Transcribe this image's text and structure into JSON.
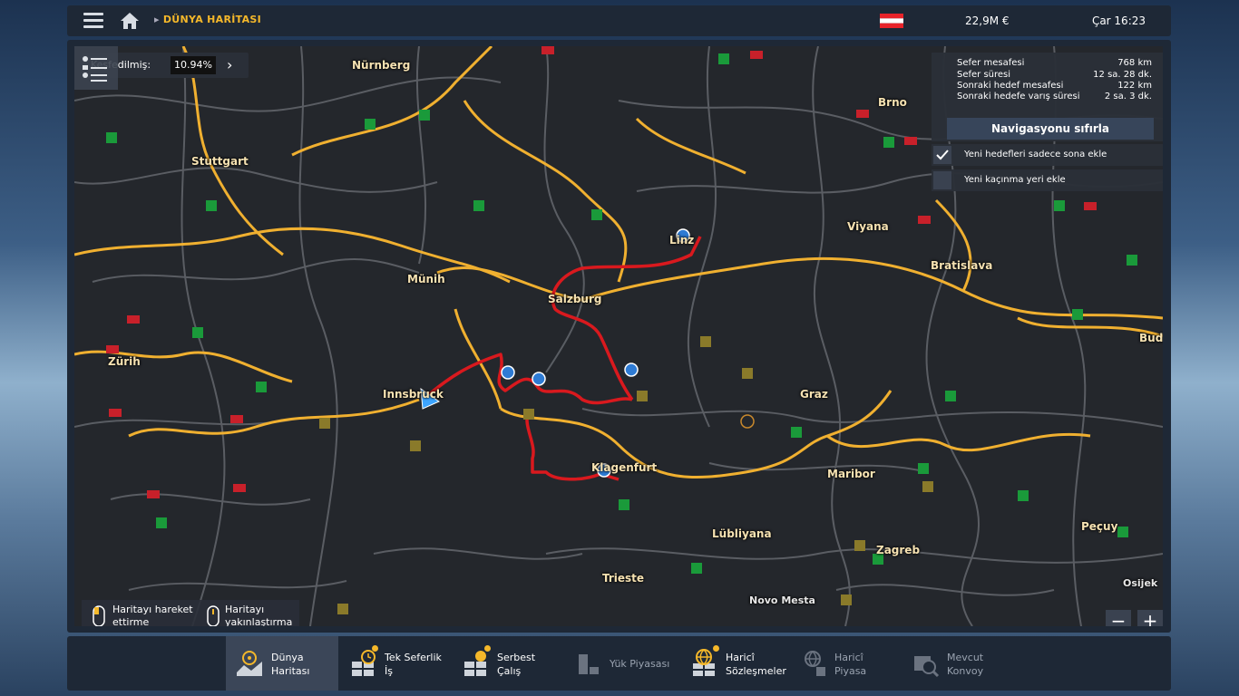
{
  "topbar": {
    "breadcrumb": "DÜNYA HARİTASI",
    "money": "22,9M  €",
    "clock": "Çar 16:23",
    "flag_colors": [
      "#e8232a",
      "#ffffff",
      "#e8232a"
    ]
  },
  "explored": {
    "label": "Keşfedilmiş:",
    "value": "10.94%"
  },
  "route_info": {
    "rows": [
      {
        "key": "Sefer mesafesi",
        "value": "768 km"
      },
      {
        "key": "Sefer süresi",
        "value": "12 sa. 28 dk."
      },
      {
        "key": "Sonraki hedef mesafesi",
        "value": "122 km"
      },
      {
        "key": "Sonraki hedefe varış süresi",
        "value": "2 sa. 3 dk."
      }
    ],
    "reset_button": "Navigasyonu sıfırla"
  },
  "options": [
    {
      "label": "Yeni hedefleri sadece sona ekle",
      "checked": true
    },
    {
      "label": "Yeni kaçınma yeri ekle",
      "checked": false
    }
  ],
  "cities": [
    "Nürnberg",
    "Stuttgart",
    "Brno",
    "Viyana",
    "Bratislava",
    "Münih",
    "Salzburg",
    "Linz",
    "Zürih",
    "Innsbruck",
    "Graz",
    "Budap",
    "Maribor",
    "Klagenfurt",
    "Lübliyana",
    "Zagreb",
    "Peçuy",
    "Trieste",
    "Novo Mesta",
    "Osijek"
  ],
  "hints": {
    "move": "Haritayı hareket\nettirme",
    "zoom": "Haritayı\nyakınlaştırma"
  },
  "zoom_out": "−",
  "zoom_in": "+",
  "bottom_tabs": [
    {
      "label": "Dünya\nHaritası",
      "active": true,
      "dim": false,
      "dot": false
    },
    {
      "label": "Tek Seferlik\nİş",
      "active": false,
      "dim": false,
      "dot": true
    },
    {
      "label": "Serbest\nÇalış",
      "active": false,
      "dim": false,
      "dot": true
    },
    {
      "label": "Yük Piyasası",
      "active": false,
      "dim": true,
      "dot": false
    },
    {
      "label": "Haricî\nSözleşmeler",
      "active": false,
      "dim": false,
      "dot": true
    },
    {
      "label": "Haricî\nPiyasa",
      "active": false,
      "dim": true,
      "dot": false
    },
    {
      "label": "Mevcut\nKonvoy",
      "active": false,
      "dim": true,
      "dot": false
    }
  ],
  "colors": {
    "accent": "#f5b82a",
    "route": "#d9191e",
    "highway": "#f0b030"
  }
}
